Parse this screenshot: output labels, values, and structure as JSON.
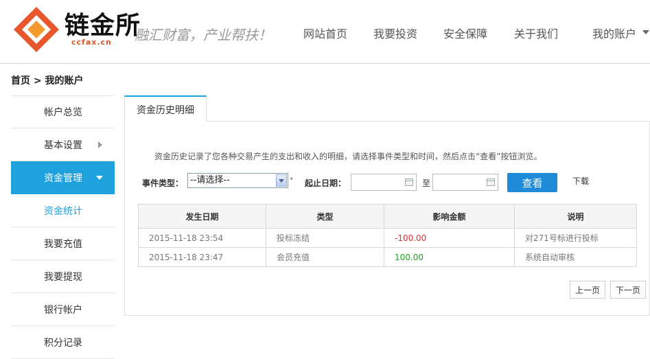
{
  "brand": {
    "name": "链金所",
    "domain": "ccfax.cn",
    "slogan": "融汇财富，产业帮扶！"
  },
  "nav": {
    "items": [
      "网站首页",
      "我要投资",
      "安全保障",
      "关于我们",
      "我的账户"
    ]
  },
  "breadcrumb": "首页 > 我的账户",
  "sidebar": {
    "items": [
      "帐户总览",
      "基本设置",
      "资金管理",
      "资金统计",
      "我要充值",
      "我要提现",
      "银行帐户",
      "积分记录"
    ],
    "active": "资金管理",
    "sub_active": "资金统计"
  },
  "tab": {
    "label": "资金历史明细"
  },
  "description": "资金历史记录了您各种交易产生的支出和收入的明细，请选择事件类型和时间，然后点击“查看”按钮浏览。",
  "filter": {
    "event_type_label": "事件类型：",
    "event_type_value": "--请选择--",
    "required_mark": "*",
    "date_label": "起止日期：",
    "to_label": "至",
    "query_button": "查看",
    "download_label": "下载"
  },
  "table": {
    "headers": [
      "发生日期",
      "类型",
      "影响金额",
      "说明"
    ],
    "rows": [
      [
        "2015-11-18 23:54",
        "投标冻结",
        "-100.00",
        "对271号标进行投标"
      ],
      [
        "2015-11-18 23:47",
        "会员充值",
        "100.00",
        "系统自动审核"
      ]
    ]
  },
  "pager": {
    "prev": "上一页",
    "next": "下一页"
  },
  "colors": {
    "accent": "#1ea1dd",
    "button": "#1f8ad8",
    "negative": "#d83030",
    "positive": "#21a021",
    "logo": "#e8572b"
  }
}
